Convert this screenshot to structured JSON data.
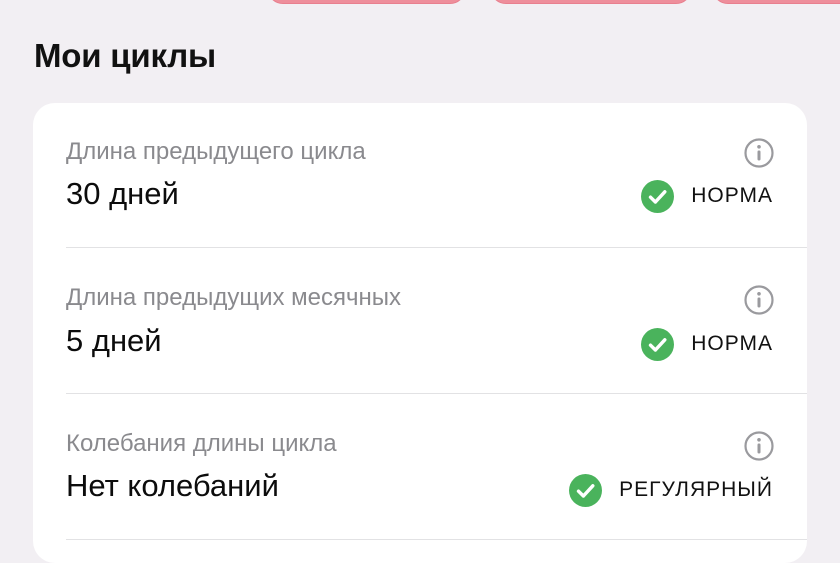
{
  "section": {
    "title": "Мои циклы"
  },
  "rows": [
    {
      "label": "Длина предыдущего цикла",
      "value": "30 дней",
      "status": "НОРМА",
      "status_icon": "check-circle-icon",
      "status_color": "#4ab35c"
    },
    {
      "label": "Длина предыдущих месячных",
      "value": "5 дней",
      "status": "НОРМА",
      "status_icon": "check-circle-icon",
      "status_color": "#4ab35c"
    },
    {
      "label": "Колебания длины цикла",
      "value": "Нет колебаний",
      "status": "РЕГУЛЯРНЫЙ",
      "status_icon": "check-circle-icon",
      "status_color": "#4ab35c"
    }
  ],
  "colors": {
    "background": "#f2eff3",
    "card": "#ffffff",
    "accent_pink": "#ee8e9b",
    "label_gray": "#8a8a8e",
    "divider": "#e2e2e4",
    "ok_green": "#4ab35c"
  }
}
